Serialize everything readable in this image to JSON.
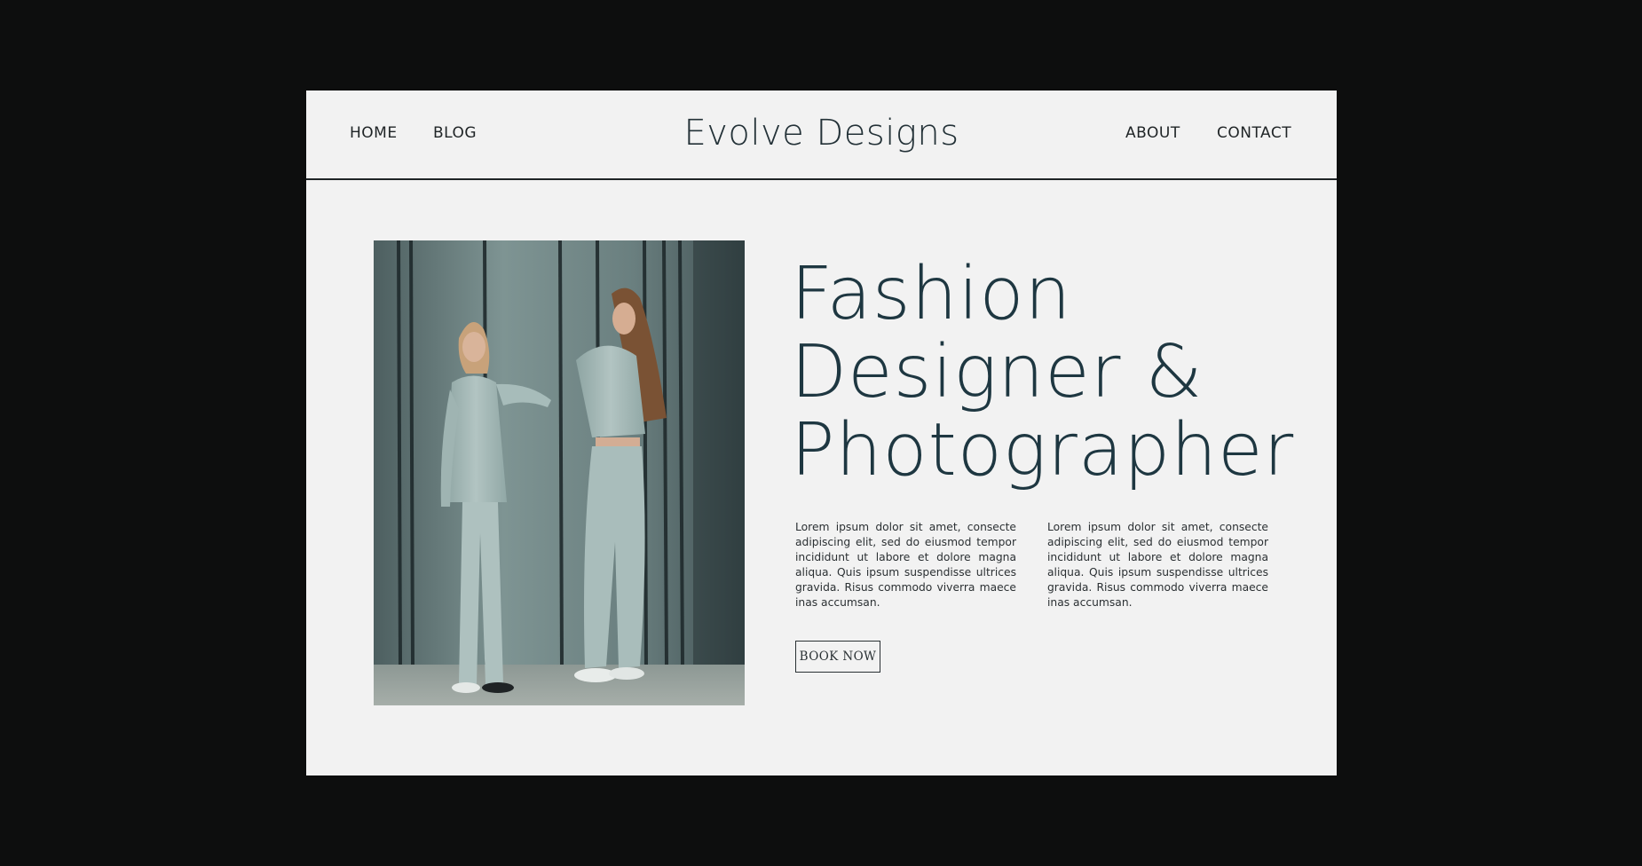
{
  "nav": {
    "left": [
      "HOME",
      "BLOG"
    ],
    "right": [
      "ABOUT",
      "CONTACT"
    ]
  },
  "brand": "Evolve Designs",
  "hero": {
    "headline": [
      "Fashion",
      "Designer &",
      "Photographer"
    ],
    "paragraphs": [
      "Lorem ipsum dolor sit amet, consecte adipiscing elit, sed do eiusmod tempor incididunt ut labore et dolore magna aliqua. Quis ipsum suspendisse ultrices gravida. Risus commodo viverra maece inas accumsan.",
      "Lorem ipsum dolor sit amet, consecte adipiscing elit, sed do eiusmod tempor incididunt ut labore et dolore magna aliqua. Quis ipsum suspendisse ultrices gravida. Risus commodo viverra maece inas accumsan."
    ],
    "cta": "BOOK NOW"
  },
  "colors": {
    "backdrop": "#0d0e0e",
    "page": "#f2f2f2",
    "heading": "#1e3741",
    "text": "#2b3033"
  }
}
